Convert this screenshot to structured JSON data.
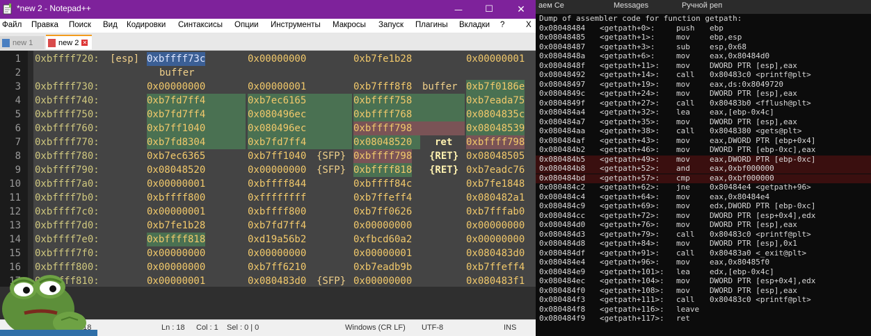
{
  "npp": {
    "title": "*new 2 - Notepad++",
    "window_controls": {
      "minimize": "—",
      "maximize": "☐",
      "close": "✕"
    },
    "menu": [
      "Файл",
      "Правка",
      "Поиск",
      "Вид",
      "Кодировки",
      "Синтаксисы",
      "Опции",
      "Инструменты",
      "Макросы",
      "Запуск",
      "Плагины",
      "Вкладки",
      "?"
    ],
    "menu_close": "X",
    "tabs": [
      {
        "label": "new 1",
        "active": false
      },
      {
        "label": "new 2",
        "active": true
      }
    ],
    "lines": [
      {
        "n": "1",
        "cols": [
          "0xbffff720:",
          "[esp]",
          "0xbffff73c",
          "0x00000000",
          "0xb7fe1b28",
          "0x00000001"
        ]
      },
      {
        "n": "2",
        "cols": [
          "",
          "",
          "buffer",
          "",
          "",
          ""
        ]
      },
      {
        "n": "3",
        "cols": [
          "0xbffff730:",
          "",
          "0x00000000",
          "0x00000001",
          "0xb7fff8f8",
          "buffer",
          "0xb7f0186e"
        ]
      },
      {
        "n": "4",
        "cols": [
          "0xbffff740:",
          "",
          "0xb7fd7ff4",
          "0xb7ec6165",
          "0xbffff758",
          "0xb7eada75"
        ]
      },
      {
        "n": "5",
        "cols": [
          "0xbffff750:",
          "",
          "0xb7fd7ff4",
          "0x080496ec",
          "0xbffff768",
          "0x0804835c"
        ]
      },
      {
        "n": "6",
        "cols": [
          "0xbffff760:",
          "",
          "0xb7ff1040",
          "0x080496ec",
          "0xbffff798",
          "0x08048539"
        ]
      },
      {
        "n": "7",
        "cols": [
          "0xbffff770:",
          "",
          "0xb7fd8304",
          "0xb7fd7ff4",
          "0x08048520",
          "ret",
          "0xbffff798"
        ]
      },
      {
        "n": "8",
        "cols": [
          "0xbffff780:",
          "",
          "0xb7ec6365",
          "0xb7ff1040",
          "{SFP}",
          "0xbffff798",
          "{RET}",
          "0x08048505"
        ]
      },
      {
        "n": "9",
        "cols": [
          "0xbffff790:",
          "",
          "0x08048520",
          "0x00000000",
          "{SFP}",
          "0xbffff818",
          "{RET}",
          "0xb7eadc76"
        ]
      },
      {
        "n": "10",
        "cols": [
          "0xbffff7a0:",
          "",
          "0x00000001",
          "0xbffff844",
          "0xbffff84c",
          "0xb7fe1848"
        ]
      },
      {
        "n": "11",
        "cols": [
          "0xbffff7b0:",
          "",
          "0xbffff800",
          "0xffffffff",
          "0xb7ffeff4",
          "0x080482a1"
        ]
      },
      {
        "n": "12",
        "cols": [
          "0xbffff7c0:",
          "",
          "0x00000001",
          "0xbffff800",
          "0xb7ff0626",
          "0xb7fffab0"
        ]
      },
      {
        "n": "13",
        "cols": [
          "0xbffff7d0:",
          "",
          "0xb7fe1b28",
          "0xb7fd7ff4",
          "0x00000000",
          "0x00000000"
        ]
      },
      {
        "n": "14",
        "cols": [
          "0xbffff7e0:",
          "",
          "0xbffff818",
          "0xd19a56b2",
          "0xfbcd60a2",
          "0x00000000"
        ]
      },
      {
        "n": "15",
        "cols": [
          "0xbffff7f0:",
          "",
          "0x00000000",
          "0x00000000",
          "0x00000001",
          "0x080483d0"
        ]
      },
      {
        "n": "16",
        "cols": [
          "0xbffff800:",
          "",
          "0x00000000",
          "0xb7ff6210",
          "0xb7eadb9b",
          "0xb7ffeff4"
        ]
      },
      {
        "n": "17",
        "cols": [
          "0xbffff810:",
          "",
          "0x00000001",
          "0x080483d0",
          "{SFP}",
          "0x00000000",
          "0x080483f1"
        ]
      }
    ],
    "status": {
      "length": "length : 18",
      "ln": "Ln : 18",
      "col": "Col : 1",
      "sel": "Sel : 0 | 0",
      "eol": "Windows (CR LF)",
      "enc": "UTF-8",
      "ins": "INS"
    }
  },
  "terminal": {
    "browser_tabs": [
      "аем Се",
      "Messages",
      "Ручной реп"
    ],
    "header": "Dump of assembler code for function getpath:",
    "rows": [
      [
        "0x08048484",
        "<getpath+0>:",
        "push",
        "ebp"
      ],
      [
        "0x08048485",
        "<getpath+1>:",
        "mov",
        "ebp,esp"
      ],
      [
        "0x08048487",
        "<getpath+3>:",
        "sub",
        "esp,0x68"
      ],
      [
        "0x0804848a",
        "<getpath+6>:",
        "mov",
        "eax,0x80484d0"
      ],
      [
        "0x0804848f",
        "<getpath+11>:",
        "mov",
        "DWORD PTR [esp],eax"
      ],
      [
        "0x08048492",
        "<getpath+14>:",
        "call",
        "0x80483c0 <printf@plt>"
      ],
      [
        "0x08048497",
        "<getpath+19>:",
        "mov",
        "eax,ds:0x8049720"
      ],
      [
        "0x0804849c",
        "<getpath+24>:",
        "mov",
        "DWORD PTR [esp],eax"
      ],
      [
        "0x0804849f",
        "<getpath+27>:",
        "call",
        "0x80483b0 <fflush@plt>"
      ],
      [
        "0x080484a4",
        "<getpath+32>:",
        "lea",
        "eax,[ebp-0x4c]"
      ],
      [
        "0x080484a7",
        "<getpath+35>:",
        "mov",
        "DWORD PTR [esp],eax"
      ],
      [
        "0x080484aa",
        "<getpath+38>:",
        "call",
        "0x8048380 <gets@plt>"
      ],
      [
        "0x080484af",
        "<getpath+43>:",
        "mov",
        "eax,DWORD PTR [ebp+0x4]"
      ],
      [
        "0x080484b2",
        "<getpath+46>:",
        "mov",
        "DWORD PTR [ebp-0xc],eax"
      ],
      [
        "0x080484b5",
        "<getpath+49>:",
        "mov",
        "eax,DWORD PTR [ebp-0xc]"
      ],
      [
        "0x080484b8",
        "<getpath+52>:",
        "and",
        "eax,0xbf000000"
      ],
      [
        "0x080484bd",
        "<getpath+57>:",
        "cmp",
        "eax,0xbf000000"
      ],
      [
        "0x080484c2",
        "<getpath+62>:",
        "jne",
        "0x80484e4 <getpath+96>"
      ],
      [
        "0x080484c4",
        "<getpath+64>:",
        "mov",
        "eax,0x80484e4"
      ],
      [
        "0x080484c9",
        "<getpath+69>:",
        "mov",
        "edx,DWORD PTR [ebp-0xc]"
      ],
      [
        "0x080484cc",
        "<getpath+72>:",
        "mov",
        "DWORD PTR [esp+0x4],edx"
      ],
      [
        "0x080484d0",
        "<getpath+76>:",
        "mov",
        "DWORD PTR [esp],eax"
      ],
      [
        "0x080484d3",
        "<getpath+79>:",
        "call",
        "0x80483c0 <printf@plt>"
      ],
      [
        "0x080484d8",
        "<getpath+84>:",
        "mov",
        "DWORD PTR [esp],0x1"
      ],
      [
        "0x080484df",
        "<getpath+91>:",
        "call",
        "0x80483a0 <_exit@plt>"
      ],
      [
        "0x080484e4",
        "<getpath+96>:",
        "mov",
        "eax,0x80485f0"
      ],
      [
        "0x080484e9",
        "<getpath+101>:",
        "lea",
        "edx,[ebp-0x4c]"
      ],
      [
        "0x080484ec",
        "<getpath+104>:",
        "mov",
        "DWORD PTR [esp+0x4],edx"
      ],
      [
        "0x080484f0",
        "<getpath+108>:",
        "mov",
        "DWORD PTR [esp],eax"
      ],
      [
        "0x080484f3",
        "<getpath+111>:",
        "call",
        "0x80483c0 <printf@plt>"
      ],
      [
        "0x080484f8",
        "<getpath+116>:",
        "leave",
        ""
      ],
      [
        "0x080484f9",
        "<getpath+117>:",
        "ret",
        ""
      ]
    ]
  },
  "colors": {
    "title_bg": "#7e229b",
    "editor_bg": "#444444",
    "green_hl": "#4a7152",
    "red_hl": "#7a5356",
    "select": "#3b5f95",
    "token": "#f2c96b"
  }
}
